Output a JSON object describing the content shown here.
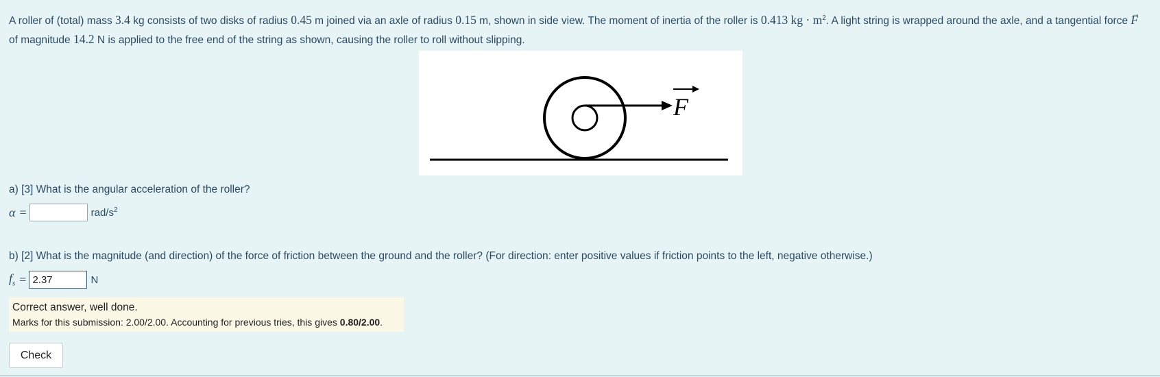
{
  "question": {
    "t1": "A roller of (total) mass ",
    "mass": "3.4",
    "t2": " kg consists of two disks of radius ",
    "disk_radius": "0.45",
    "t3": " m joined via an axle of radius ",
    "axle_radius": "0.15",
    "t4": " m, shown in side view.  The moment of inertia of the roller is ",
    "inertia": "0.413",
    "inertia_unit": "kg · m",
    "inertia_exp": "2",
    "t5": ".  A light string is wrapped around the axle, and a tangential force ",
    "force_symbol": "F",
    "t6": " of magnitude ",
    "force_mag": "14.2",
    "t7": " N is applied to the free end of the string as shown, causing the roller to roll without slipping."
  },
  "figure": {
    "force_label": "F"
  },
  "part_a": {
    "question": "a) [3] What is the angular acceleration of the roller?",
    "var": "α",
    "eq": "=",
    "value": "",
    "unit": "rad/s",
    "unit_exp": "2"
  },
  "part_b": {
    "question": "b) [2]  What is the magnitude (and direction) of the force of friction between the ground and the roller?  (For direction: enter positive values if friction points to the left, negative otherwise.)",
    "var": "f",
    "var_sub": "s",
    "eq": "=",
    "value": "2.37",
    "unit": "N"
  },
  "feedback": {
    "line1": "Correct answer, well done.",
    "line2_prefix": "Marks for this submission: 2.00/2.00. Accounting for previous tries, this gives ",
    "line2_bold": "0.80/2.00",
    "line2_suffix": "."
  },
  "check_label": "Check"
}
